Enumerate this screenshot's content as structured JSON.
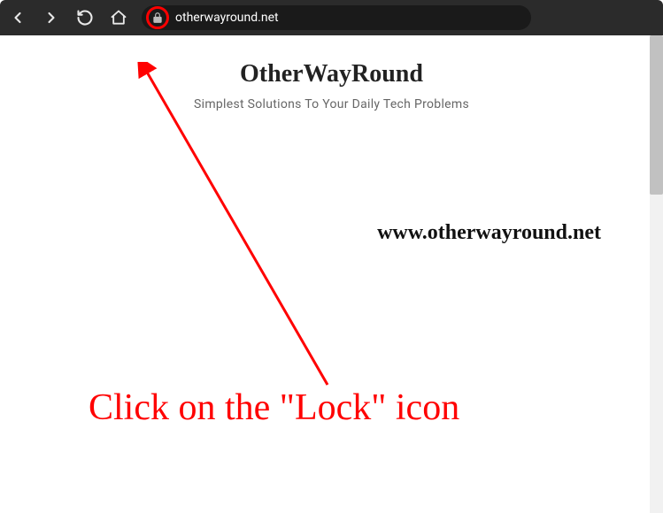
{
  "toolbar": {
    "url": "otherwayround.net"
  },
  "page": {
    "title": "OtherWayRound",
    "tagline": "Simplest Solutions To Your Daily Tech Problems"
  },
  "annotation": {
    "watermark": "www.otherwayround.net",
    "instruction": "Click on the \"Lock\" icon",
    "color": "#ff0000"
  }
}
